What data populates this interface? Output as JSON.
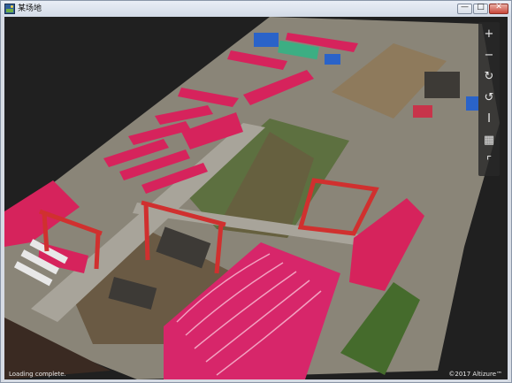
{
  "window": {
    "title": "某场地",
    "controls": {
      "minimize": "—",
      "maximize": "□",
      "close": "✕"
    },
    "app_icon": "aerial-photo-icon"
  },
  "toolbar": {
    "items": [
      {
        "icon": "zoom-in-icon",
        "glyph": "+"
      },
      {
        "icon": "zoom-out-icon",
        "glyph": "−"
      },
      {
        "icon": "rotate-clockwise-icon",
        "glyph": "↻"
      },
      {
        "icon": "rotate-counterclockwise-icon",
        "glyph": "↺"
      },
      {
        "icon": "measure-height-icon",
        "glyph": "I"
      },
      {
        "icon": "grid-view-icon",
        "glyph": "▦"
      },
      {
        "icon": "corner-view-icon",
        "glyph": "⌜"
      }
    ]
  },
  "status": {
    "text": "Loading complete."
  },
  "footer": {
    "copyright": "©2017 Altizure™"
  }
}
